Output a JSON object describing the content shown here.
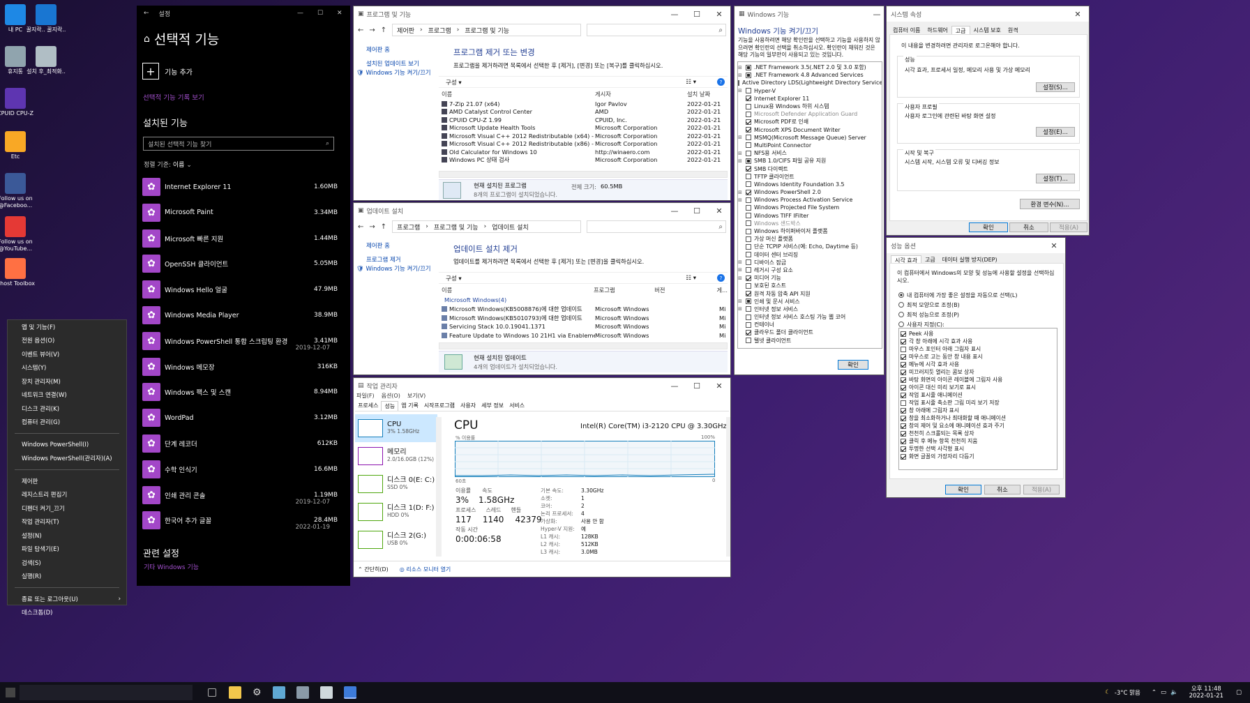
{
  "desktop": {
    "icons": [
      {
        "label": "내 PC",
        "color": "#1e88e5"
      },
      {
        "label": "꿀지락.. 꿀지락..",
        "color": "#1976d2"
      },
      {
        "label": "휴지통",
        "color": "#90a4ae"
      },
      {
        "label": "설치 후_최적화..",
        "color": "#b0bec5"
      },
      {
        "label": "CPUID CPU-Z",
        "color": "#5e35b1"
      },
      {
        "label": "Etc",
        "color": "#f9a825"
      },
      {
        "label": "Follow us on @Faceboo...",
        "color": "#3b5998"
      },
      {
        "label": "Follow us on @YouTube...",
        "color": "#e53935"
      },
      {
        "label": "Ghost Toolbox",
        "color": "#ff7043"
      }
    ]
  },
  "winx_menu": {
    "items": [
      "앱 및 기능(F)",
      "전원 옵션(O)",
      "이벤트 뷰어(V)",
      "시스템(Y)",
      "장치 관리자(M)",
      "네트워크 연결(W)",
      "디스크 관리(K)",
      "컴퓨터 관리(G)",
      "Windows PowerShell(I)",
      "Windows PowerShell(관리자)(A)",
      "제어판",
      "레지스트리 편집기",
      "디펜더 켜기_끄기",
      "작업 관리자(T)",
      "설정(N)",
      "파일 탐색기(E)",
      "검색(S)",
      "실행(R)",
      "종료 또는 로그아웃(U)",
      "데스크톱(D)"
    ]
  },
  "settings": {
    "title": "설정",
    "heading": "선택적 기능",
    "add_feature": "기능 추가",
    "history_link": "선택적 기능 기록 보기",
    "installed_heading": "설치된 기능",
    "search_placeholder": "설치된 선택적 기능 찾기",
    "sort_label": "정렬 기준:",
    "sort_value": "이름",
    "related_heading": "관련 설정",
    "related_link": "기타 Windows 기능",
    "features": [
      {
        "name": "Internet Explorer 11",
        "size": "1.60MB",
        "date": ""
      },
      {
        "name": "Microsoft Paint",
        "size": "3.34MB",
        "date": ""
      },
      {
        "name": "Microsoft 빠른 지원",
        "size": "1.44MB",
        "date": ""
      },
      {
        "name": "OpenSSH 클라이언트",
        "size": "5.05MB",
        "date": ""
      },
      {
        "name": "Windows Hello 얼굴",
        "size": "47.9MB",
        "date": ""
      },
      {
        "name": "Windows Media Player",
        "size": "38.9MB",
        "date": ""
      },
      {
        "name": "Windows PowerShell 통합 스크립팅 환경",
        "size": "3.41MB",
        "date": "2019-12-07"
      },
      {
        "name": "Windows 메모장",
        "size": "316KB",
        "date": ""
      },
      {
        "name": "Windows 팩스 및 스캔",
        "size": "8.94MB",
        "date": ""
      },
      {
        "name": "WordPad",
        "size": "3.12MB",
        "date": ""
      },
      {
        "name": "단계 레코더",
        "size": "612KB",
        "date": ""
      },
      {
        "name": "수학 인식기",
        "size": "16.6MB",
        "date": ""
      },
      {
        "name": "인쇄 관리 콘솔",
        "size": "1.19MB",
        "date": "2019-12-07"
      },
      {
        "name": "한국어 추가 글꼴",
        "size": "28.4MB",
        "date": "2022-01-19"
      }
    ]
  },
  "programs": {
    "title": "프로그램 및 기능",
    "breadcrumb": [
      "제어판",
      "프로그램",
      "프로그램 및 기능"
    ],
    "side_home": "제어판 홈",
    "side_updates": "설치된 업데이트 보기",
    "side_features": "Windows 기능 켜기/끄기",
    "heading": "프로그램 제거 또는 변경",
    "desc": "프로그램을 제거하려면 목록에서 선택한 후 [제거], [변경] 또는 [복구]를 클릭하십시오.",
    "organize": "구성",
    "cols": [
      "이름",
      "게시자",
      "설치 날짜"
    ],
    "rows": [
      [
        "7-Zip 21.07 (x64)",
        "Igor Pavlov",
        "2022-01-21"
      ],
      [
        "AMD Catalyst Control Center",
        "AMD",
        "2022-01-21"
      ],
      [
        "CPUID CPU-Z 1.99",
        "CPUID, Inc.",
        "2022-01-21"
      ],
      [
        "Microsoft Update Health Tools",
        "Microsoft Corporation",
        "2022-01-21"
      ],
      [
        "Microsoft Visual C++ 2012 Redistributable (x64) - 11.0.50...",
        "Microsoft Corporation",
        "2022-01-21"
      ],
      [
        "Microsoft Visual C++ 2012 Redistributable (x86) - 11.0.50...",
        "Microsoft Corporation",
        "2022-01-21"
      ],
      [
        "Old Calculator for Windows 10",
        "http://winaero.com",
        "2022-01-21"
      ],
      [
        "Windows PC 상태 검사",
        "Microsoft Corporation",
        "2022-01-21"
      ]
    ],
    "footer_title": "현재 설치된 프로그램",
    "footer_total": "전체 크기:",
    "footer_size": "60.5MB",
    "footer_count": "8개의 프로그램이 설치되었습니다."
  },
  "updates": {
    "title": "업데이트 설치",
    "breadcrumb": [
      "프로그램",
      "프로그램 및 기능",
      "업데이트 설치"
    ],
    "side_home": "제어판 홈",
    "side_remove": "프로그램 제거",
    "side_features": "Windows 기능 켜기/끄기",
    "heading": "업데이트 설치 제거",
    "desc": "업데이트를 제거하려면 목록에서 선택한 후 [제거] 또는 [변경]을 클릭하십시오.",
    "organize": "구성",
    "cols": [
      "이름",
      "프로그램",
      "버전",
      "게..."
    ],
    "group": "Microsoft Windows(4)",
    "rows": [
      [
        "Microsoft Windows(KB5008876)에 대한 업데이트",
        "Microsoft Windows",
        "Mi"
      ],
      [
        "Microsoft Windows(KB5010793)에 대한 업데이트",
        "Microsoft Windows",
        "Mi"
      ],
      [
        "Servicing Stack 10.0.19041.1371",
        "Microsoft Windows",
        "Mi"
      ],
      [
        "Feature Update to Windows 10 21H1 via Enablement Pack...",
        "Microsoft Windows",
        "Mi"
      ]
    ],
    "footer_title": "현재 설치된 업데이트",
    "footer_count": "4개의 업데이트가 설치되었습니다."
  },
  "features_win": {
    "title": "Windows 기능",
    "heading": "Windows 기능 켜기/끄기",
    "desc": "기능을 사용하려면 해당 확인란을 선택하고 기능을 사용하지 않으려면 확인란의 선택을 취소하십시오. 확인란이 채워진 것은 해당 기능의 일부만이 사용되고 있는 것입니다.",
    "items": [
      {
        "label": ".NET Framework 3.5(.NET 2.0 및 3.0 포함)",
        "state": "part",
        "exp": true
      },
      {
        "label": ".NET Framework 4.8 Advanced Services",
        "state": "part",
        "exp": true
      },
      {
        "label": "Active Directory LDS(Lightweight Directory Services)",
        "state": "off",
        "exp": false
      },
      {
        "label": "Hyper-V",
        "state": "off",
        "exp": true
      },
      {
        "label": "Internet Explorer 11",
        "state": "on",
        "exp": false
      },
      {
        "label": "Linux용 Windows 하위 시스템",
        "state": "off",
        "exp": false
      },
      {
        "label": "Microsoft Defender Application Guard",
        "state": "off",
        "exp": false
      },
      {
        "label": "Microsoft PDF로 인쇄",
        "state": "on",
        "exp": false
      },
      {
        "label": "Microsoft XPS Document Writer",
        "state": "on",
        "exp": false
      },
      {
        "label": "MSMQ(Microsoft Message Queue) Server",
        "state": "off",
        "exp": true
      },
      {
        "label": "MultiPoint Connector",
        "state": "off",
        "exp": false
      },
      {
        "label": "NFS용 서비스",
        "state": "off",
        "exp": true
      },
      {
        "label": "SMB 1.0/CIFS 파일 공유 지원",
        "state": "part",
        "exp": true
      },
      {
        "label": "SMB 다이렉트",
        "state": "on",
        "exp": false
      },
      {
        "label": "TFTP 클라이언트",
        "state": "off",
        "exp": false
      },
      {
        "label": "Windows Identity Foundation 3.5",
        "state": "off",
        "exp": false
      },
      {
        "label": "Windows PowerShell 2.0",
        "state": "on",
        "exp": true
      },
      {
        "label": "Windows Process Activation Service",
        "state": "off",
        "exp": true
      },
      {
        "label": "Windows Projected File System",
        "state": "off",
        "exp": false
      },
      {
        "label": "Windows TIFF IFilter",
        "state": "off",
        "exp": false
      },
      {
        "label": "Windows 샌드박스",
        "state": "off",
        "exp": false
      },
      {
        "label": "Windows 하이퍼바이저 플랫폼",
        "state": "off",
        "exp": false
      },
      {
        "label": "가상 머신 플랫폼",
        "state": "off",
        "exp": false
      },
      {
        "label": "단순 TCPIP 서비스(예: Echo, Daytime 등)",
        "state": "off",
        "exp": false
      },
      {
        "label": "데이터 센터 브리징",
        "state": "off",
        "exp": false
      },
      {
        "label": "디바이스 잠금",
        "state": "off",
        "exp": true
      },
      {
        "label": "레거시 구성 요소",
        "state": "off",
        "exp": true
      },
      {
        "label": "미디어 기능",
        "state": "on",
        "exp": true
      },
      {
        "label": "보호된 호스트",
        "state": "off",
        "exp": false
      },
      {
        "label": "원격 차동 압축 API 지원",
        "state": "on",
        "exp": false
      },
      {
        "label": "인쇄 및 문서 서비스",
        "state": "part",
        "exp": true
      },
      {
        "label": "인터넷 정보 서비스",
        "state": "off",
        "exp": true
      },
      {
        "label": "인터넷 정보 서비스 호스팅 가능 웹 코어",
        "state": "off",
        "exp": false
      },
      {
        "label": "컨테이너",
        "state": "off",
        "exp": false
      },
      {
        "label": "클라우드 폴더 클라이언트",
        "state": "on",
        "exp": false
      },
      {
        "label": "텔넷 클라이언트",
        "state": "off",
        "exp": false
      }
    ],
    "ok": "확인"
  },
  "sysprops": {
    "title": "시스템 속성",
    "tabs": [
      "컴퓨터 이름",
      "하드웨어",
      "고급",
      "시스템 보호",
      "원격"
    ],
    "notice": "이 내용을 변경하려면 관리자로 로그온해야 합니다.",
    "perf_title": "성능",
    "perf_desc": "시각 효과, 프로세서 일정, 메모리 사용 및 가상 메모리",
    "profile_title": "사용자 프로필",
    "profile_desc": "사용자 로그인에 관련된 바탕 화면 설정",
    "startup_title": "시작 및 복구",
    "startup_desc": "시스템 시작, 시스템 오류 및 디버깅 정보",
    "settings_btn": "설정(S)...",
    "settings_btn2": "설정(E)...",
    "settings_btn3": "설정(T)...",
    "env_btn": "환경 변수(N)...",
    "ok": "확인",
    "cancel": "취소",
    "apply": "적용(A)"
  },
  "perfopts": {
    "title": "성능 옵션",
    "tabs": [
      "시각 효과",
      "고급",
      "데이터 실행 방지(DEP)"
    ],
    "desc": "이 컴퓨터에서 Windows의 모양 및 성능에 사용할 설정을 선택하십시오.",
    "radios": [
      "내 컴퓨터에 가장 좋은 설정을 자동으로 선택(L)",
      "최적 모양으로 조정(B)",
      "최적 성능으로 조정(P)",
      "사용자 지정(C):"
    ],
    "checks": [
      {
        "label": "Peek 사용",
        "on": true
      },
      {
        "label": "각 창 아래에 시각 효과 사용",
        "on": true
      },
      {
        "label": "마우스 포인터 아래 그림자 표시",
        "on": false
      },
      {
        "label": "마우스로 고는 동안 창 내용 표시",
        "on": true
      },
      {
        "label": "메뉴에 시각 효과 사용",
        "on": true
      },
      {
        "label": "미끄러지듯 열리는 콤보 상자",
        "on": true
      },
      {
        "label": "바탕 화면의 아이콘 레이블에 그림자 사용",
        "on": true
      },
      {
        "label": "아이콘 대신 미리 보기로 표시",
        "on": true
      },
      {
        "label": "작업 표시줄 애니메이션",
        "on": true
      },
      {
        "label": "작업 표시줄 축소판 그림 미리 보기 저장",
        "on": false
      },
      {
        "label": "창 아래에 그림자 표시",
        "on": true
      },
      {
        "label": "창을 최소화하거나 최대화할 때 애니메이션",
        "on": true
      },
      {
        "label": "창의 제어 및 요소에 애니메이션 효과 주기",
        "on": true
      },
      {
        "label": "천천히 스크롤되는 목록 상자",
        "on": true
      },
      {
        "label": "클릭 후 메뉴 항목 천천히 지움",
        "on": true
      },
      {
        "label": "투명한 선택 사각형 표시",
        "on": true
      },
      {
        "label": "화면 글꼴의 가장자리 다듬기",
        "on": true
      }
    ],
    "ok": "확인",
    "cancel": "취소",
    "apply": "적용(A)"
  },
  "taskmgr": {
    "title": "작업 관리자",
    "menu": [
      "파일(F)",
      "옵션(O)",
      "보기(V)"
    ],
    "tabs": [
      "프로세스",
      "성능",
      "앱 기록",
      "시작프로그램",
      "사용자",
      "세부 정보",
      "서비스"
    ],
    "side": [
      {
        "name": "CPU",
        "sub": "3% 1.58GHz",
        "color": "#117dbb"
      },
      {
        "name": "메모리",
        "sub": "2.0/16.0GB (12%)",
        "color": "#8b12ae"
      },
      {
        "name": "디스크 0(E: C:)",
        "sub": "SSD 0%",
        "color": "#4da60c"
      },
      {
        "name": "디스크 1(D: F:)",
        "sub": "HDD 0%",
        "color": "#4da60c"
      },
      {
        "name": "디스크 2(G:)",
        "sub": "USB 0%",
        "color": "#4da60c"
      }
    ],
    "cpu_title": "CPU",
    "cpu_model": "Intel(R) Core(TM) i3-2120 CPU @ 3.30GHz",
    "usage_label": "% 이용률",
    "max_label": "100%",
    "time_label": "60초",
    "zero_label": "0",
    "stats": {
      "util_label": "이용률",
      "util": "3%",
      "speed_label": "속도",
      "speed": "1.58GHz",
      "proc_label": "프로세스",
      "proc": "117",
      "thread_label": "스레드",
      "thread": "1140",
      "handle_label": "핸들",
      "handle": "42379",
      "uptime_label": "작동 시간",
      "uptime": "0:00:06:58"
    },
    "info": [
      [
        "기본 속도:",
        "3.30GHz"
      ],
      [
        "소켓:",
        "1"
      ],
      [
        "코어:",
        "2"
      ],
      [
        "논리 프로세서:",
        "4"
      ],
      [
        "가상화:",
        "사용 안 함"
      ],
      [
        "Hyper-V 지원:",
        "예"
      ],
      [
        "L1 캐시:",
        "128KB"
      ],
      [
        "L2 캐시:",
        "512KB"
      ],
      [
        "L3 캐시:",
        "3.0MB"
      ]
    ],
    "brief": "간단히(D)",
    "monitor": "리소스 모니터 열기"
  },
  "taskbar": {
    "weather": "-3°C 맑음",
    "time": "오후 11:48",
    "date": "2022-01-21"
  }
}
